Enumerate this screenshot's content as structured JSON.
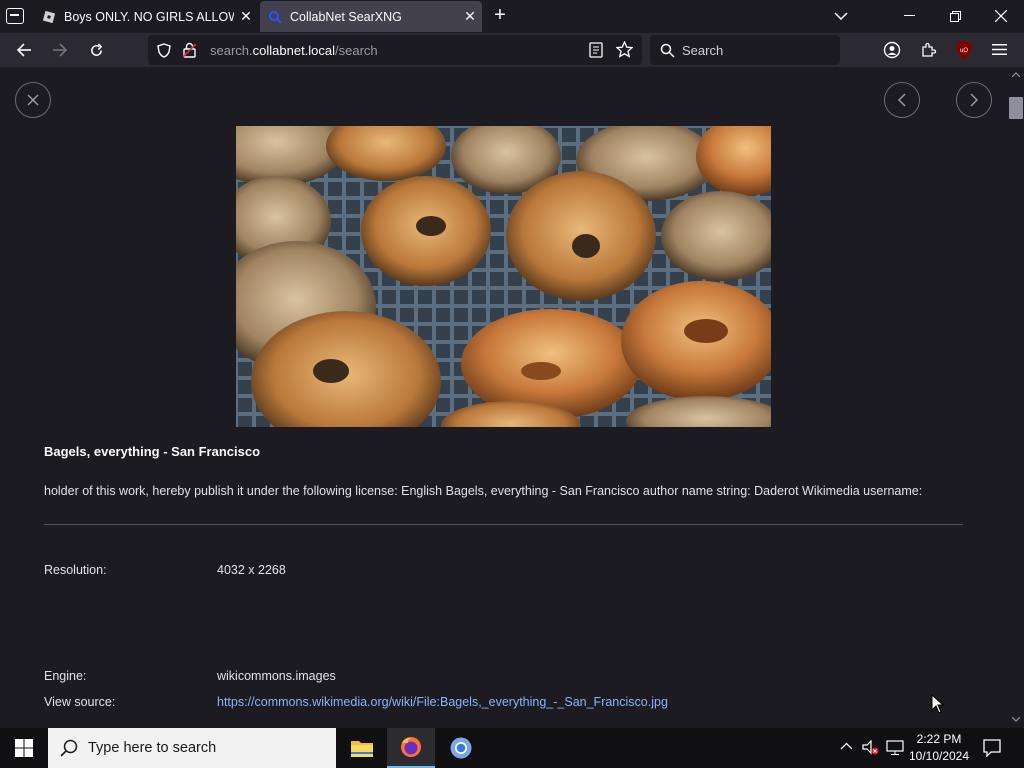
{
  "tabs": [
    {
      "title": "Boys ONLY. NO GIRLS ALLOWED",
      "active": false,
      "favicon": "roblox-icon"
    },
    {
      "title": "CollabNet SearXNG",
      "active": true,
      "favicon": "searxng-search-icon"
    }
  ],
  "urlbar": {
    "host_prefix": "search.",
    "host": "collabnet.local",
    "path": "/search"
  },
  "searchbar": {
    "placeholder": "Search"
  },
  "result": {
    "title": "Bagels, everything - San Francisco",
    "description": "holder of this work, hereby publish it under the following license: English Bagels, everything - San Francisco author name string: Daderot Wikimedia username:",
    "image_alt": "Bagels, everything - San Francisco"
  },
  "meta": {
    "resolution_label": "Resolution:",
    "resolution_value": "4032 x 2268",
    "engine_label": "Engine:",
    "engine_value": "wikicommons.images",
    "source_label": "View source:",
    "source_value": "https://commons.wikimedia.org/wiki/File:Bagels,_everything_-_San_Francisco.jpg"
  },
  "taskbar": {
    "search_placeholder": "Type here to search",
    "time": "2:22 PM",
    "date": "10/10/2024"
  },
  "colors": {
    "link": "#8ab4f8",
    "active_tab": "#42414d",
    "page_bg": "#1c1b22"
  }
}
